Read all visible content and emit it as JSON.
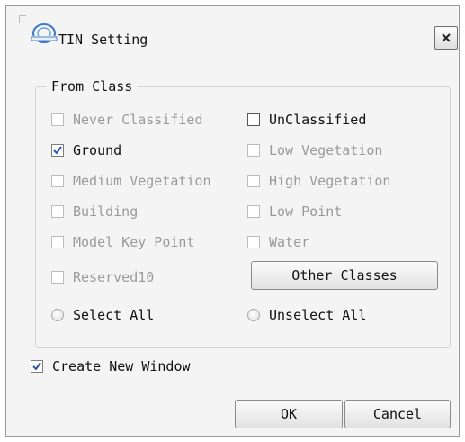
{
  "window": {
    "title": "TIN Setting",
    "icon": "lidar360-logo-icon"
  },
  "from_class": {
    "label": "From Class",
    "items": [
      {
        "label": "Never Classified",
        "checked": false,
        "enabled": false
      },
      {
        "label": "UnClassified",
        "checked": false,
        "enabled": true
      },
      {
        "label": "Ground",
        "checked": true,
        "enabled": true
      },
      {
        "label": "Low Vegetation",
        "checked": false,
        "enabled": false
      },
      {
        "label": "Medium Vegetation",
        "checked": false,
        "enabled": false
      },
      {
        "label": "High Vegetation",
        "checked": false,
        "enabled": false
      },
      {
        "label": "Building",
        "checked": false,
        "enabled": false
      },
      {
        "label": "Low Point",
        "checked": false,
        "enabled": false
      },
      {
        "label": "Model Key Point",
        "checked": false,
        "enabled": false
      },
      {
        "label": "Water",
        "checked": false,
        "enabled": false
      },
      {
        "label": "Reserved10",
        "checked": false,
        "enabled": false
      }
    ],
    "other_classes_label": "Other Classes",
    "select_all_label": "Select All",
    "unselect_all_label": "Unselect All"
  },
  "create_new_window": {
    "label": "Create New Window",
    "checked": true
  },
  "buttons": {
    "ok": "OK",
    "cancel": "Cancel"
  },
  "colors": {
    "check": "#2a56a8",
    "disabled_text": "#9a9a9a"
  }
}
